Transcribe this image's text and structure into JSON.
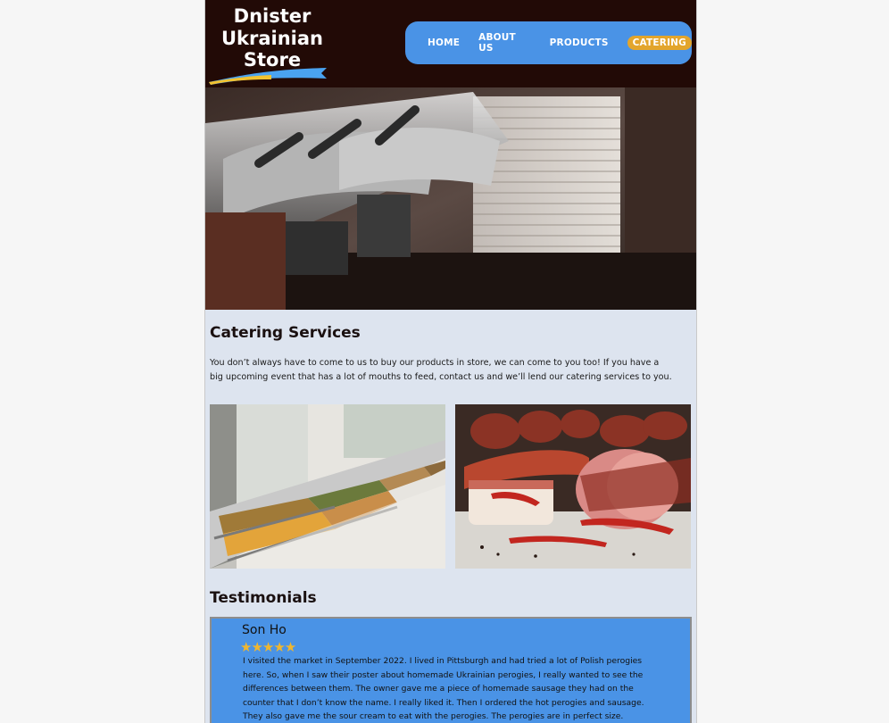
{
  "header": {
    "logo": {
      "line1": "Dnister",
      "line2": "Ukrainian",
      "line3": "Store"
    },
    "nav": [
      {
        "label": "HOME"
      },
      {
        "label": "ABOUT US"
      },
      {
        "label": "PRODUCTS"
      },
      {
        "label": "CATERING",
        "active": true
      }
    ]
  },
  "main": {
    "catering": {
      "title": "Catering Services",
      "text": "You don’t always have to come to us to buy our products in store, we can come to you too! If you have a big upcoming event that has a lot of mouths to feed, contact us and we’ll lend our catering services to you."
    },
    "testimonials": {
      "title": "Testimonials",
      "items": [
        {
          "name": "Son Ho",
          "stars": "★★★★★",
          "rating": 5,
          "text": "I visited the market in September 2022. I lived in Pittsburgh and had tried a lot of Polish perogies here. So, when I saw their poster about homemade Ukrainian perogies, I really wanted to see the differences between them. The owner gave me a piece of homemade sausage they had on the counter that I don’t know the name. I really liked it. Then I ordered the hot perogies and sausage. They also gave me the sour cream to eat with the perogies. The perogies are in perfect size."
        }
      ]
    }
  },
  "colors": {
    "header_bg": "#220a06",
    "nav_bg": "#4a93e6",
    "nav_active": "#e3a52c",
    "page_bg": "#dde4ef",
    "testimonial_bg": "#4a93e6",
    "star": "#f0b62f"
  }
}
